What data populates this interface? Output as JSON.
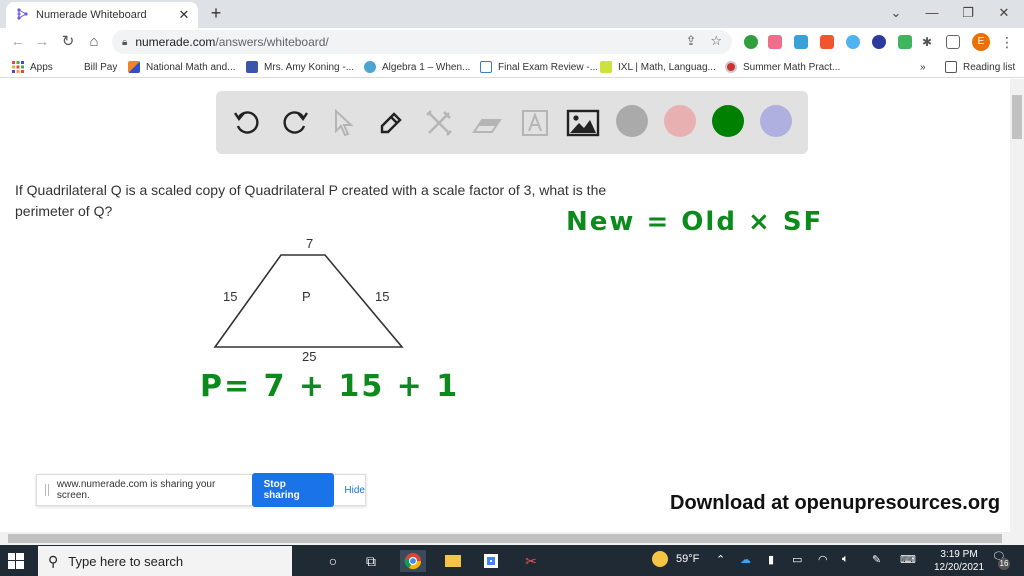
{
  "browser": {
    "tab": {
      "title": "Numerade Whiteboard",
      "favicon": "numerade-logo-icon"
    },
    "new_tab_label": "+",
    "window_controls": {
      "tab_search": "⌄",
      "minimize": "—",
      "restore": "❐",
      "close": "✕"
    },
    "nav": {
      "back": "←",
      "forward": "→",
      "reload": "↻",
      "home": "⌂"
    },
    "address": {
      "host": "numerade.com",
      "path": "/answers/whiteboard/"
    },
    "extensions": [
      {
        "name": "green-plus-extension",
        "color": "#2e9e3e"
      },
      {
        "name": "pink-arrow-extension",
        "color": "#f06e8a"
      },
      {
        "name": "cloud-extension",
        "color": "#3aa0d8"
      },
      {
        "name": "red-tag-extension",
        "color": "#f2542d"
      },
      {
        "name": "diamond-extension",
        "color": "#4fb3f0"
      },
      {
        "name": "k-extension",
        "color": "#2b3a9c"
      },
      {
        "name": "smiley-extension",
        "color": "#3fb55f"
      }
    ],
    "profile_initial": "E",
    "bookmarks": [
      {
        "label": "Apps",
        "icon": "apps-grid-icon"
      },
      {
        "label": "Bill Pay",
        "icon": ""
      },
      {
        "label": "National Math and...",
        "icon": "national-math-icon"
      },
      {
        "label": "Mrs. Amy Koning -...",
        "icon": "calendar-icon"
      },
      {
        "label": "Algebra 1 – When...",
        "icon": "wordpress-icon"
      },
      {
        "label": "Final Exam Review -...",
        "icon": "form-icon"
      },
      {
        "label": "IXL | Math, Languag...",
        "icon": "ixl-icon"
      },
      {
        "label": "Summer Math Pract...",
        "icon": "summer-math-icon"
      }
    ],
    "bookmarks_overflow": "»",
    "reading_list": "Reading list"
  },
  "whiteboard": {
    "tools": [
      {
        "name": "undo",
        "enabled": true
      },
      {
        "name": "redo",
        "enabled": true
      },
      {
        "name": "select",
        "enabled": false
      },
      {
        "name": "pen",
        "enabled": true
      },
      {
        "name": "shapes",
        "enabled": false
      },
      {
        "name": "eraser",
        "enabled": false
      },
      {
        "name": "text",
        "enabled": false
      },
      {
        "name": "image",
        "enabled": true
      }
    ],
    "colors": [
      "#aaaaaa",
      "#e8b0b0",
      "#008000",
      "#b0b0e0"
    ],
    "question": "If Quadrilateral Q is a scaled copy of Quadrilateral P created with a scale factor of 3, what is the perimeter of Q?",
    "figure": {
      "shape_label": "P",
      "top": "7",
      "left": "15",
      "right": "15",
      "bottom": "25"
    },
    "handwriting": {
      "formula": "New = Old × SF",
      "perimeter": "P= 7 + 15 + 1"
    },
    "ink_color": "#0c8a1c",
    "watermark": "Download at openupresources.org"
  },
  "share_bar": {
    "message": "www.numerade.com is sharing your screen.",
    "stop_label": "Stop sharing",
    "hide_label": "Hide"
  },
  "taskbar": {
    "search_placeholder": "Type here to search",
    "weather": "59°F",
    "time": "3:19 PM",
    "date": "12/20/2021",
    "notifications": "16"
  }
}
